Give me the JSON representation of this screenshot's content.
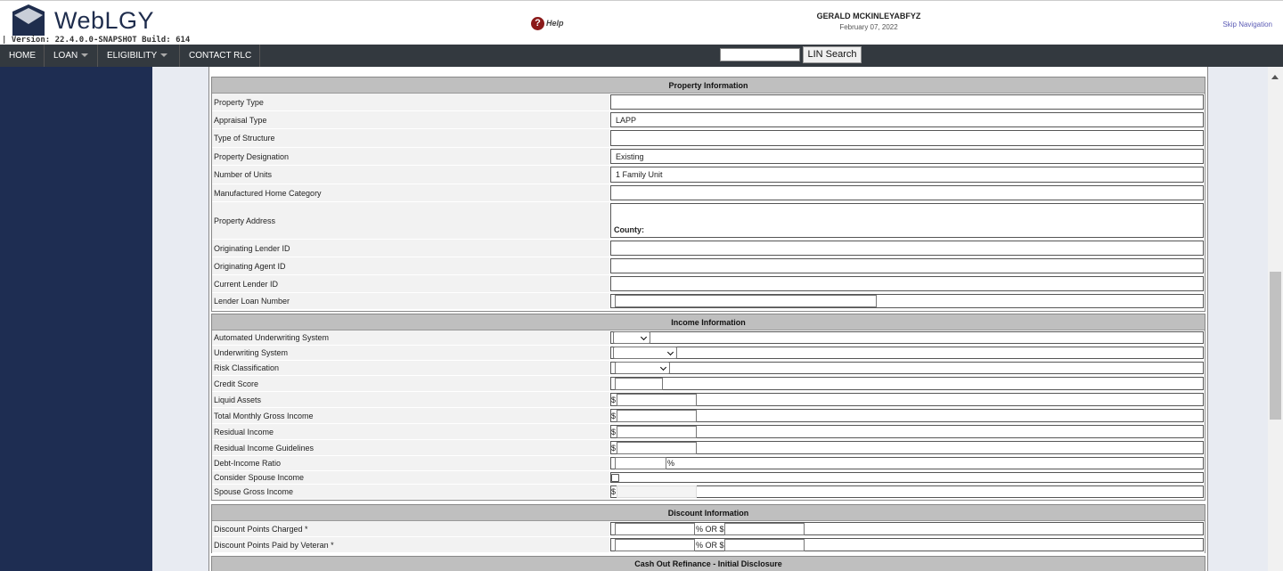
{
  "header": {
    "app_name": "WebLGY",
    "version": "| Version: 22.4.0.0-SNAPSHOT Build: 614",
    "help_label": "Help",
    "user_name": "GERALD MCKINLEYABFYZ",
    "date": "February 07, 2022",
    "skip_nav": "Skip Navigation"
  },
  "nav": {
    "home": "HOME",
    "loan": "LOAN",
    "eligibility": "ELIGIBILITY",
    "contact": "CONTACT RLC",
    "lin_search_value": "",
    "lin_search_button": "LIN Search"
  },
  "property": {
    "title": "Property Information",
    "rows": [
      {
        "label": "Property Type",
        "value": ""
      },
      {
        "label": "Appraisal Type",
        "value": "LAPP"
      },
      {
        "label": "Type of Structure",
        "value": ""
      },
      {
        "label": "Property Designation",
        "value": "Existing"
      },
      {
        "label": "Number of Units",
        "value": "1 Family Unit"
      },
      {
        "label": "Manufactured Home Category",
        "value": ""
      },
      {
        "label": "Property Address",
        "value": "",
        "county_label": "County:"
      },
      {
        "label": "Originating Lender ID",
        "value": ""
      },
      {
        "label": "Originating Agent ID",
        "value": ""
      },
      {
        "label": "Current Lender ID",
        "value": ""
      },
      {
        "label": "Lender Loan Number",
        "value": ""
      }
    ]
  },
  "income": {
    "title": "Income Information",
    "rows": [
      {
        "label": "Automated Underwriting System"
      },
      {
        "label": "Underwriting System"
      },
      {
        "label": "Risk Classification"
      },
      {
        "label": "Credit Score",
        "value": ""
      },
      {
        "label": "Liquid Assets",
        "prefix": "$",
        "value": ""
      },
      {
        "label": "Total Monthly Gross Income",
        "prefix": "$",
        "value": ""
      },
      {
        "label": "Residual Income",
        "prefix": "$",
        "value": ""
      },
      {
        "label": "Residual Income Guidelines",
        "prefix": "$",
        "value": ""
      },
      {
        "label": "Debt-Income Ratio",
        "value": "",
        "suffix": "%"
      },
      {
        "label": "Consider Spouse Income",
        "checked": false
      },
      {
        "label": "Spouse Gross Income",
        "prefix": "$",
        "value": ""
      }
    ]
  },
  "discount": {
    "title": "Discount Information",
    "rows": [
      {
        "label": "Discount Points Charged *",
        "mid": "% OR $"
      },
      {
        "label": "Discount Points Paid by Veteran *",
        "mid": "% OR $"
      }
    ]
  },
  "cashout": {
    "title": "Cash Out Refinance - Initial Disclosure"
  }
}
